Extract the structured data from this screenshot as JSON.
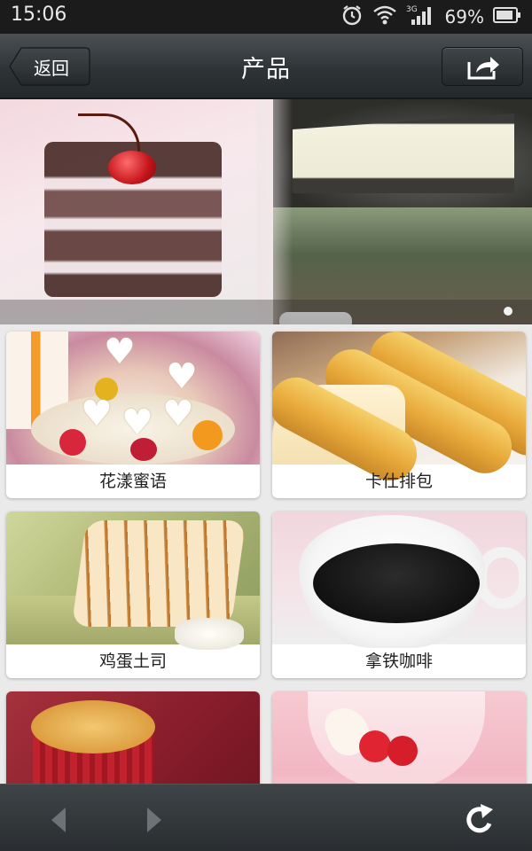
{
  "status_bar": {
    "time": "15:06",
    "battery_pct": "69%",
    "network_label": "3G",
    "icons": [
      "alarm-icon",
      "wifi-icon",
      "signal-icon",
      "battery-icon"
    ]
  },
  "nav": {
    "back_label": "返回",
    "title": "产品",
    "share_icon": "share-icon"
  },
  "banner": {
    "slide_count_visible": 1,
    "active_dot": 1
  },
  "products": [
    {
      "name": "花漾蜜语"
    },
    {
      "name": "卡仕排包"
    },
    {
      "name": "鸡蛋土司"
    },
    {
      "name": "拿铁咖啡"
    },
    {
      "name": ""
    },
    {
      "name": ""
    }
  ],
  "toolbar": {
    "icons": [
      "back-arrow-icon",
      "forward-arrow-icon",
      "refresh-icon"
    ]
  },
  "colors": {
    "nav_bg": "#2f3437",
    "status_bg": "#1b1b1b",
    "page_bg": "#eaeaea",
    "card_bg": "#ffffff"
  }
}
